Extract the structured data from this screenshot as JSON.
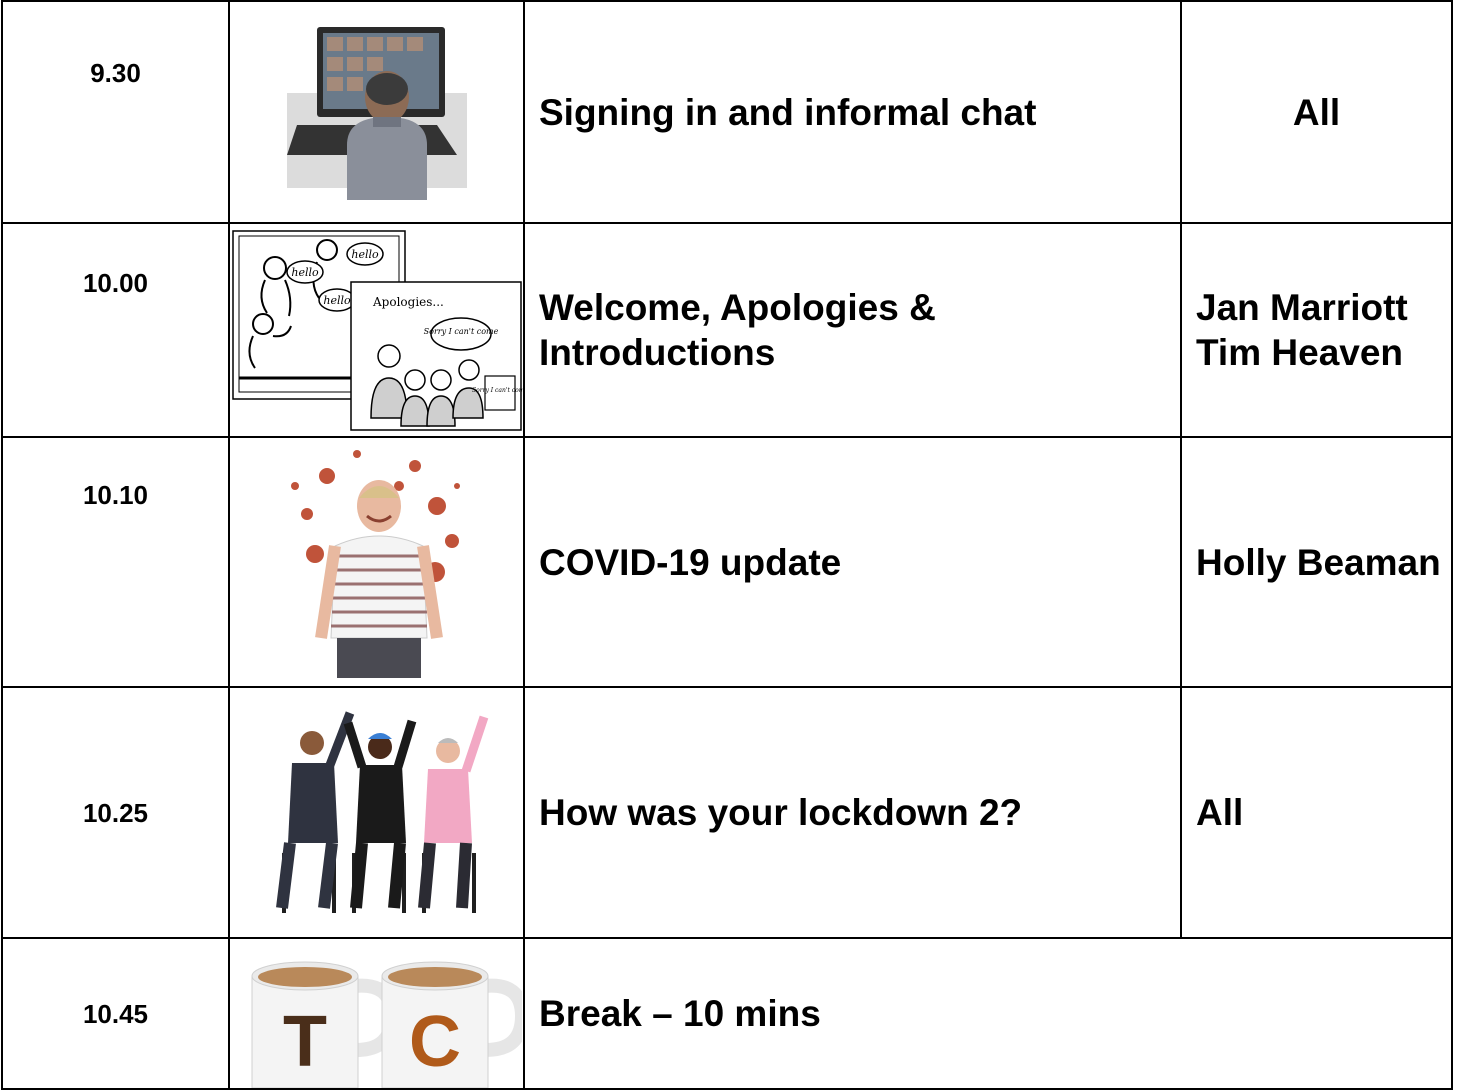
{
  "rows": [
    {
      "time": "9.30",
      "image_icon": "person-on-video-call-icon",
      "activity": "Signing in and informal chat",
      "who": [
        "All"
      ]
    },
    {
      "time": "10.00",
      "image_icon": "welcome-apologies-drawing-icon",
      "image_text": {
        "hello": "hello",
        "apologies": "Apologies...",
        "sorry": "Sorry I can't come"
      },
      "activity": "Welcome, Apologies & Introductions",
      "who": [
        "Jan Marriott",
        "Tim Heaven"
      ]
    },
    {
      "time": "10.10",
      "image_icon": "man-with-virus-icon",
      "activity": "COVID-19 update",
      "who": [
        "Holly Beaman"
      ]
    },
    {
      "time": "10.25",
      "image_icon": "people-raising-hands-icon",
      "activity": "How was your lockdown 2?",
      "who": [
        "All"
      ]
    },
    {
      "time": "10.45",
      "image_icon": "tea-and-coffee-mugs-icon",
      "image_text": {
        "mug1": "T",
        "mug2": "C"
      },
      "activity": "Break – 10 mins",
      "who": []
    }
  ]
}
